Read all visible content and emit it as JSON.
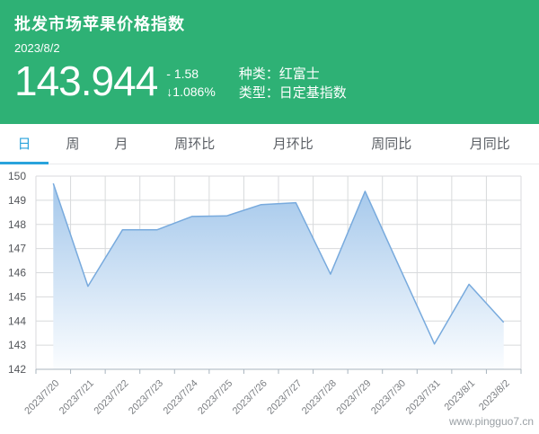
{
  "header": {
    "title": "批发市场苹果价格指数",
    "date": "2023/8/2",
    "value": "143.944",
    "change": "- 1.58",
    "change_pct": "↓1.086%",
    "variety": "种类：红富士",
    "index_type": "类型：日定基指数",
    "bg_color": "#2eb175"
  },
  "tabs": [
    {
      "label": "日",
      "active": true
    },
    {
      "label": "周",
      "active": false
    },
    {
      "label": "月",
      "active": false
    },
    {
      "label": "周环比",
      "active": false
    },
    {
      "label": "月环比",
      "active": false
    },
    {
      "label": "周同比",
      "active": false
    },
    {
      "label": "月同比",
      "active": false
    }
  ],
  "chart_data": {
    "type": "area",
    "title": "",
    "xlabel": "",
    "ylabel": "",
    "x": [
      "2023/7/20",
      "2023/7/21",
      "2023/7/22",
      "2023/7/23",
      "2023/7/24",
      "2023/7/25",
      "2023/7/26",
      "2023/7/27",
      "2023/7/28",
      "2023/7/29",
      "2023/7/30",
      "2023/7/31",
      "2023/8/1",
      "2023/8/2"
    ],
    "values": [
      149.7,
      145.44,
      147.78,
      147.78,
      148.33,
      148.35,
      148.82,
      148.9,
      145.94,
      149.37,
      146.2,
      143.05,
      145.52,
      143.944
    ],
    "ylim": [
      142,
      150
    ],
    "y_ticks": [
      142,
      143,
      144,
      145,
      146,
      147,
      148,
      149,
      150
    ],
    "grid": true,
    "legend": "none",
    "colors": {
      "line": "#78aadd",
      "area_top": "#a0c5ea",
      "area_bottom": "#fbfdff",
      "grid": "#d8dadc",
      "axis": "#a8b4be",
      "y_label": "#53565a",
      "x_label": "#7b7e82"
    }
  },
  "watermark": "www.pingguo7.cn"
}
